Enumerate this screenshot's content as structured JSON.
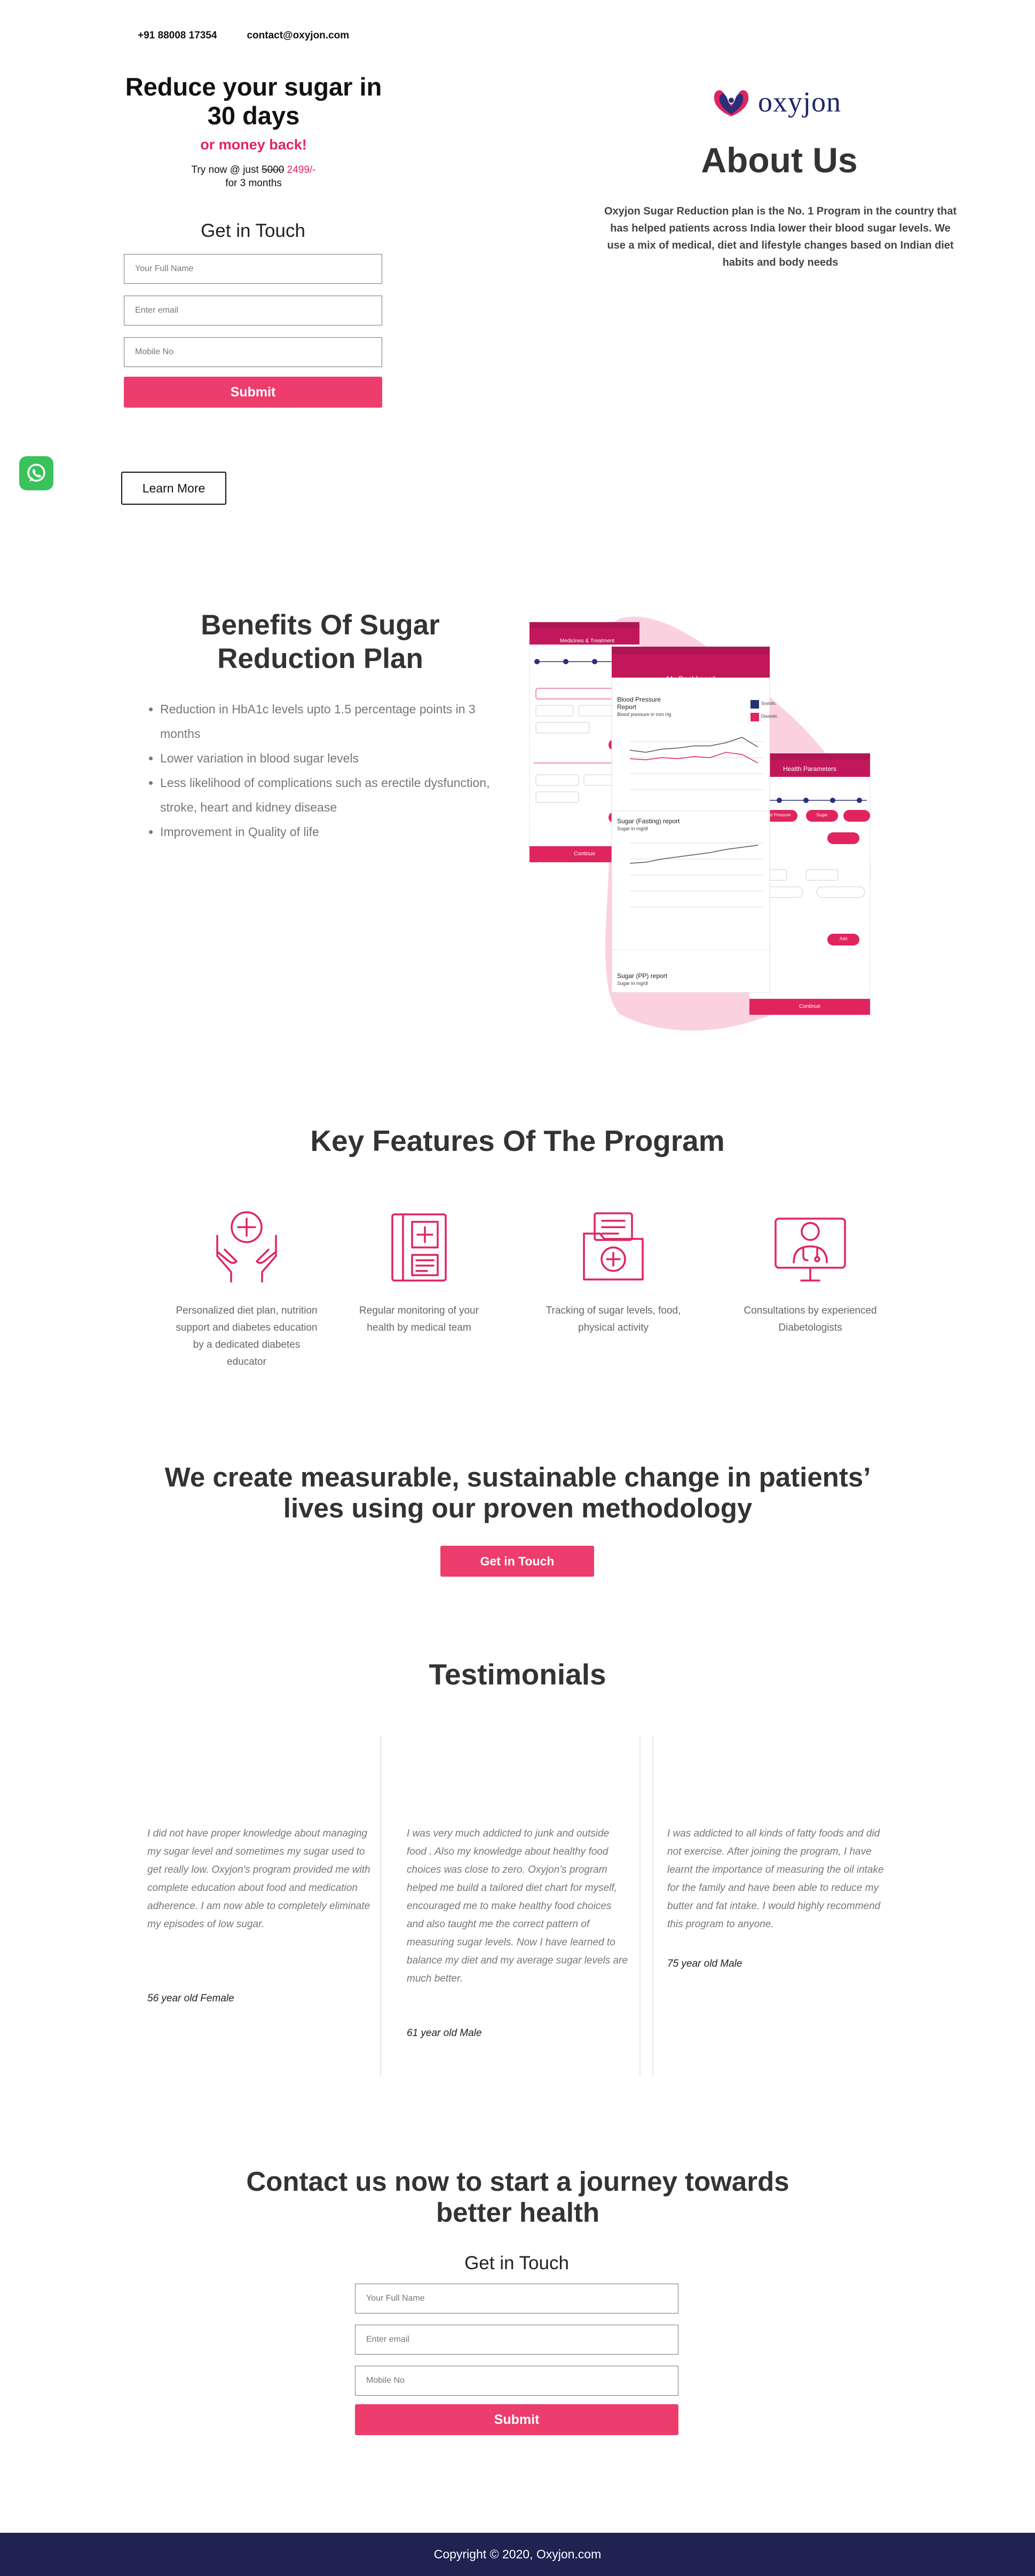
{
  "topbar": {
    "phone": "+91 88008 17354",
    "email": "contact@oxyjon.com"
  },
  "hero": {
    "title": "Reduce your sugar in 30 days",
    "subtitle": "or money back!",
    "try_prefix": "Try now @ just",
    "old_price": "5000",
    "new_price": "2499/-",
    "duration": "for 3 months"
  },
  "form_top": {
    "title": "Get in Touch",
    "name_placeholder": "Your Full Name",
    "email_placeholder": "Enter email",
    "mobile_placeholder": "Mobile No",
    "submit_label": "Submit"
  },
  "learn_more_label": "Learn More",
  "about": {
    "logo_text": "oxyjon",
    "title": "About Us",
    "text": "Oxyjon Sugar Reduction plan is the No. 1 Program in the country that has helped patients across India lower their blood sugar levels. We use a mix of medical, diet and lifestyle changes based on Indian diet habits and body needs"
  },
  "benefits": {
    "title": "Benefits Of Sugar Reduction Plan",
    "items": [
      "Reduction in HbA1c levels upto 1.5 percentage points in 3 months",
      "Lower variation in blood sugar levels",
      "Less likelihood of complications such as erectile dysfunction, stroke, heart and kidney disease",
      "Improvement in Quality of life"
    ]
  },
  "phones": {
    "left_header": "Medicines & Treatment",
    "left_button": "Continue",
    "center_header": "My Dashboard",
    "bp_title": "Blood Pressure Report",
    "bp_sub": "Blood pressure in mm Hg",
    "legend_systolic": "Systolic",
    "legend_diastolic": "Diastolic",
    "fasting_title": "Sugar (Fasting) report",
    "fasting_sub": "Sugar in mg/dl",
    "pp_title": "Sugar (PP) report",
    "pp_sub": "Sugar in mg/dl",
    "right_header": "Health Parameters",
    "right_tab1": "Blood Pressure",
    "right_tab2": "Sugar",
    "right_button_add": "Add",
    "right_button": "Continue"
  },
  "features": {
    "title": "Key Features Of The Program",
    "items": [
      {
        "icon": "care-hands-icon",
        "text": "Personalized diet plan, nutrition support and diabetes education by a dedicated diabetes educator"
      },
      {
        "icon": "medical-report-icon",
        "text": "Regular monitoring of your health by medical team"
      },
      {
        "icon": "medical-folder-icon",
        "text": "Tracking of sugar levels, food, physical activity"
      },
      {
        "icon": "doctor-consult-icon",
        "text": "Consultations by experienced Diabetologists"
      }
    ]
  },
  "measure": {
    "title": "We create measurable, sustainable change in patients’ lives using our proven methodology",
    "button": "Get in Touch"
  },
  "testimonials": {
    "title": "Testimonials",
    "items": [
      {
        "text": "I did not have proper knowledge about managing my sugar level and sometimes my sugar used to get really low. Oxyjon's program provided me with complete education about food and medication adherence. I am now able to completely eliminate my episodes of low sugar.",
        "author": "56 year old Female"
      },
      {
        "text": "I was very much addicted to junk and outside food . Also my knowledge about healthy food choices was close to zero. Oxyjon’s program helped me build a tailored diet chart for myself, encouraged me to make healthy food choices and also taught me the correct pattern of measuring sugar levels. Now I have learned to balance my diet and my average sugar levels are much better.",
        "author": "61 year old Male"
      },
      {
        "text": "I was addicted to all kinds of fatty foods and did not exercise. After joining the program, I have learnt the importance of measuring the oil intake for the family and have been able to reduce my butter and fat intake. I would highly recommend this program to anyone.",
        "author": "75 year old Male"
      }
    ]
  },
  "contact": {
    "title": "Contact us now to start a journey towards better health",
    "form_title": "Get in Touch",
    "name_placeholder": "Your Full Name",
    "email_placeholder": "Enter email",
    "mobile_placeholder": "Mobile No",
    "submit_label": "Submit"
  },
  "footer": {
    "copyright": "Copyright © 2020, Oxyjon.com"
  },
  "colors": {
    "accent": "#ec3d6d",
    "brand_navy": "#1e2352",
    "whatsapp": "#3ac25b",
    "phone_header": "#c2185b"
  }
}
